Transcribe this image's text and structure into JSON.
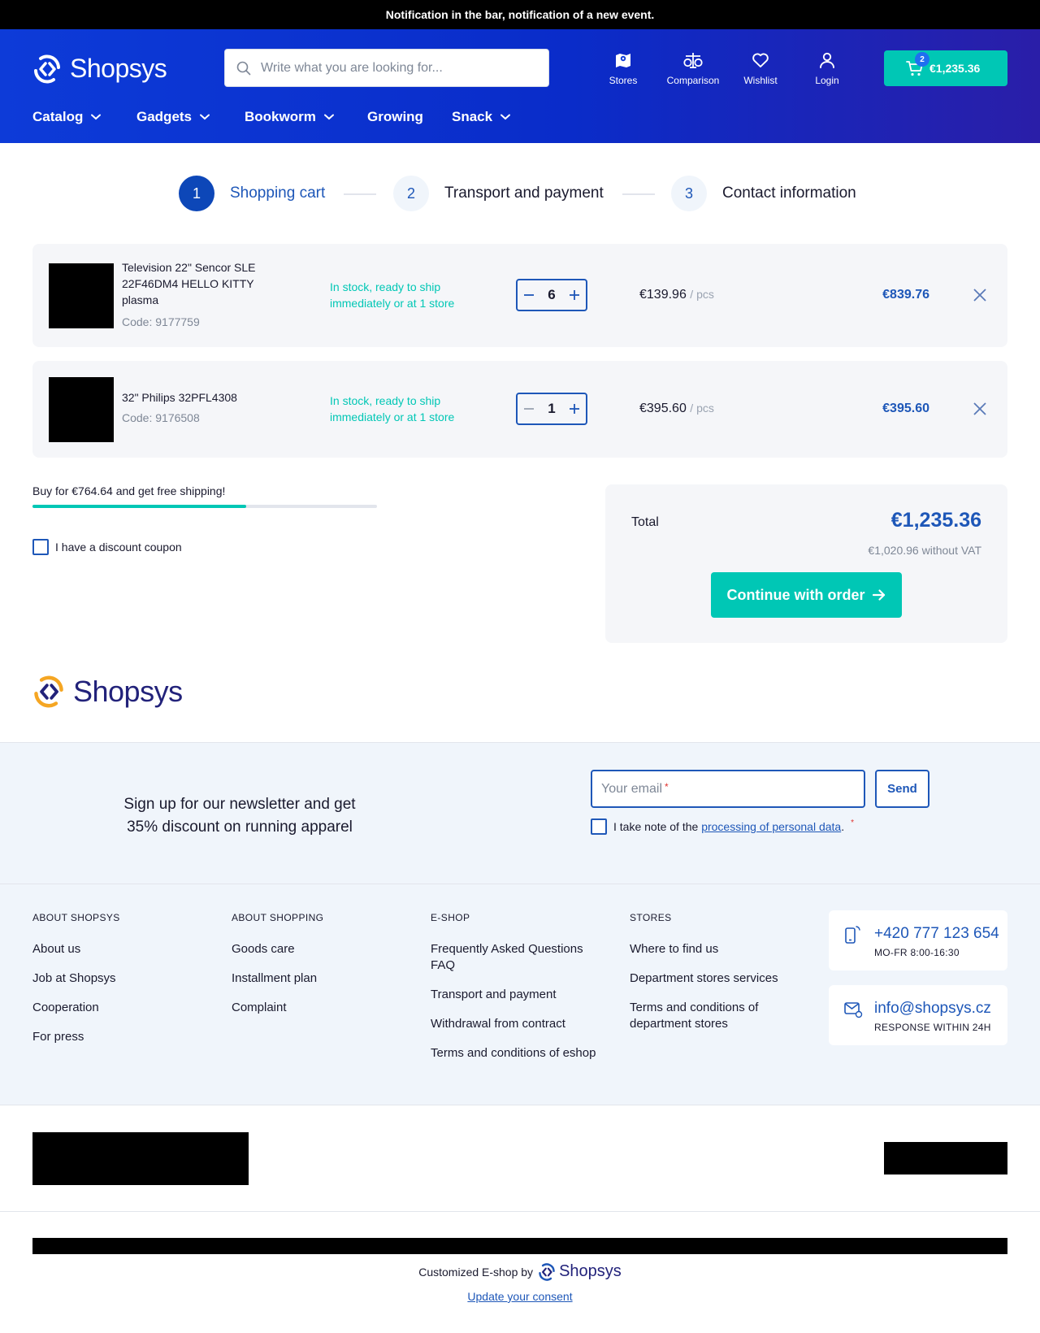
{
  "notification": "Notification in the bar, notification of a new event.",
  "header": {
    "brand": "Shopsys",
    "search_placeholder": "Write what you are looking for...",
    "icons": [
      {
        "label": "Stores",
        "icon": "map-icon"
      },
      {
        "label": "Comparison",
        "icon": "scales-icon"
      },
      {
        "label": "Wishlist",
        "icon": "heart-icon"
      },
      {
        "label": "Login",
        "icon": "user-icon"
      }
    ],
    "cart": {
      "count": "2",
      "total": "€1,235.36"
    },
    "nav": [
      "Catalog",
      "Gadgets",
      "Bookworm",
      "Growing",
      "Snack"
    ]
  },
  "steps": [
    {
      "num": "1",
      "label": "Shopping cart"
    },
    {
      "num": "2",
      "label": "Transport and payment"
    },
    {
      "num": "3",
      "label": "Contact information"
    }
  ],
  "cart_items": [
    {
      "name": "Television 22\" Sencor SLE 22F46DM4 HELLO KITTY plasma",
      "code": "Code: 9177759",
      "stock": "In stock, ready to ship immediately or at 1 store",
      "qty": "6",
      "unit_price": "€139.96",
      "unit": "/ pcs",
      "total": "€839.76"
    },
    {
      "name": "32\" Philips 32PFL4308",
      "code": "Code: 9176508",
      "stock": "In stock, ready to ship immediately or at 1 store",
      "qty": "1",
      "unit_price": "€395.60",
      "unit": "/ pcs",
      "total": "€395.60"
    }
  ],
  "free_shipping": {
    "text": "Buy for €764.64 and get free shipping!",
    "progress": 0.62
  },
  "coupon_label": "I have a discount coupon",
  "summary": {
    "total_label": "Total",
    "total": "€1,235.36",
    "without_vat": "€1,020.96 without VAT",
    "continue": "Continue with order"
  },
  "footer_brand": "Shopsys",
  "newsletter": {
    "text": "Sign up for our newsletter and get 35% discount on running apparel",
    "email_placeholder": "Your email",
    "required_mark": "*",
    "send": "Send",
    "consent_prefix": "I take note of the",
    "consent_link": "processing of personal data",
    "consent_suffix": "."
  },
  "footer": {
    "columns": [
      {
        "title": "ABOUT SHOPSYS",
        "links": [
          "About us",
          "Job at Shopsys",
          "Cooperation",
          "For press"
        ]
      },
      {
        "title": "ABOUT SHOPPING",
        "links": [
          "Goods care",
          "Installment plan",
          "Complaint"
        ]
      },
      {
        "title": "E-SHOP",
        "links": [
          "Frequently Asked Questions FAQ",
          "Transport and payment",
          "Withdrawal from contract",
          "Terms and conditions of eshop"
        ]
      },
      {
        "title": "STORES",
        "links": [
          "Where to find us",
          "Department stores services",
          "Terms and conditions of department stores"
        ]
      }
    ],
    "phone": {
      "value": "+420 777 123 654",
      "hours": "MO-FR 8:00-16:30"
    },
    "email": {
      "value": "info@shopsys.cz",
      "note": "RESPONSE WITHIN 24H"
    }
  },
  "credit": {
    "text": "Customized E-shop by",
    "brand": "Shopsys"
  },
  "update_consent": "Update your consent",
  "colors": {
    "primary": "#1e57b8",
    "accent": "#00c7b5",
    "header": "#0d3bd8"
  }
}
